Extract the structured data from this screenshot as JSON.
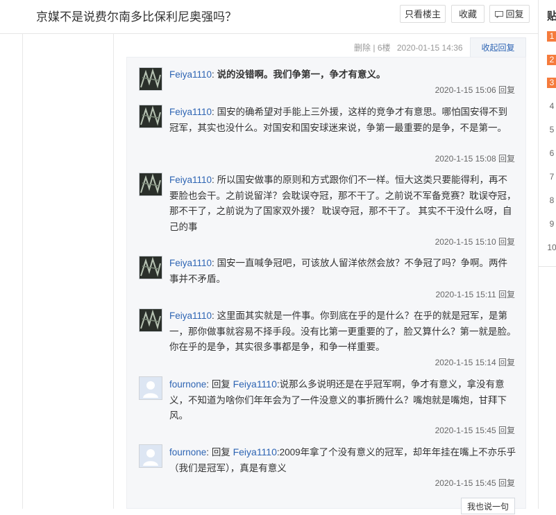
{
  "header": {
    "title": "京媒不是说费尔南多比保利尼奥强吗？",
    "only_op_label": "只看楼主",
    "favorite_label": "收藏",
    "reply_label": "回复"
  },
  "sidebar": {
    "heading": "贴",
    "pages": [
      "1",
      "2",
      "3",
      "4",
      "5",
      "6",
      "7",
      "8",
      "9",
      "10"
    ]
  },
  "post": {
    "delete_label": "删除",
    "floor": "6楼",
    "timestamp": "2020-01-15 14:36",
    "collapse_label": "收起回复"
  },
  "replies": [
    {
      "user": "Feiya1110",
      "reply_to": "",
      "text": "说的没错啊。我们争第一，争才有意义。",
      "bold": true,
      "time": "2020-1-15 15:06",
      "action": "回复"
    },
    {
      "user": "Feiya1110",
      "reply_to": "",
      "text": "国安的确希望对手能上三外援，这样的竞争才有意思。哪怕国安得不到冠军，其实也没什么。对国安和国安球迷来说，争第一最重要的是争，不是第一。",
      "bold": false,
      "time": "2020-1-15 15:08",
      "action": "回复"
    },
    {
      "user": "Feiya1110",
      "reply_to": "",
      "text": "所以国安做事的原则和方式跟你们不一样。恒大这类只要能得利，再不要脸也会干。之前说留洋？会耽误夺冠，那不干了。之前说不军备竞赛？耽误夺冠，那不干了，之前说为了国家双外援？ 耽误夺冠，那不干了。 其实不干没什么呀，自己的事",
      "bold": false,
      "time": "2020-1-15 15:10",
      "action": "回复"
    },
    {
      "user": "Feiya1110",
      "reply_to": "",
      "text": "国安一直喊争冠吧，可该放人留洋依然会放？不争冠了吗？争啊。两件事并不矛盾。",
      "bold": false,
      "time": "2020-1-15 15:11",
      "action": "回复"
    },
    {
      "user": "Feiya1110",
      "reply_to": "",
      "text": "这里面其实就是一件事。你到底在乎的是什么？在乎的就是冠军，是第一，那你做事就容易不择手段。没有比第一更重要的了，脸又算什么？第一就是脸。你在乎的是争，其实很多事都是争，和争一样重要。",
      "bold": false,
      "time": "2020-1-15 15:14",
      "action": "回复"
    },
    {
      "user": "fournone",
      "reply_to": "Feiya1110",
      "text": ":说那么多说明还是在乎冠军啊，争才有意义，拿没有意义，不知道为啥你们年年会为了一件没意义的事折腾什么？嘴炮就是嘴炮，甘拜下风。",
      "bold": false,
      "time": "2020-1-15 15:45",
      "action": "回复"
    },
    {
      "user": "fournone",
      "reply_to": "Feiya1110",
      "text": ":2009年拿了个没有意义的冠军，却年年挂在嘴上不亦乐乎（我们是冠军），真是有意义",
      "bold": false,
      "time": "2020-1-15 15:45",
      "action": "回复"
    }
  ],
  "reply_word": "回复",
  "input_stub_label": "我也说一句",
  "colors": {
    "link": "#2d64b3",
    "hot_rank": "#f57b3c",
    "panel_bg": "#f6f7f9"
  }
}
